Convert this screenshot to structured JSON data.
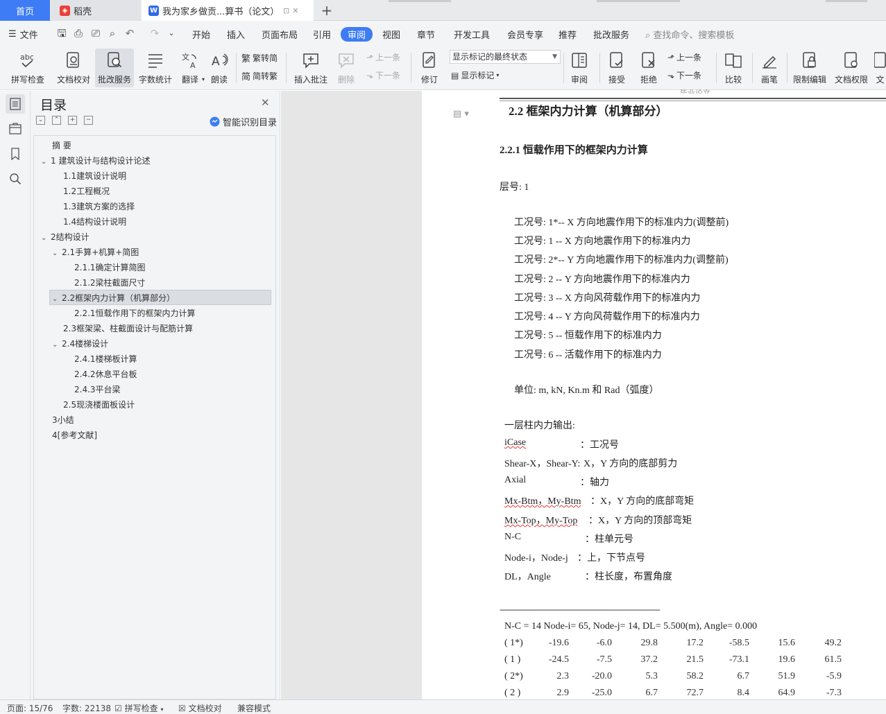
{
  "tabs": {
    "home": "首页",
    "docer": "稻壳",
    "doc_title": "我为家乡做贡...算书（论文）"
  },
  "menu": {
    "file": "文件",
    "items": [
      "开始",
      "插入",
      "页面布局",
      "引用",
      "审阅",
      "视图",
      "章节",
      "开发工具",
      "会员专享",
      "推荐",
      "批改服务"
    ],
    "active": "审阅",
    "search_placeholder": "查找命令、搜索模板"
  },
  "ribbon": {
    "spellcheck": "拼写检查",
    "doc_check": "文档校对",
    "correct_service": "批改服务",
    "word_count": "字数统计",
    "translate": "翻译",
    "read_aloud": "朗读",
    "trad_to_simp": "繁转简",
    "simp_to_trad": "简转繁",
    "insert_comment": "插入批注",
    "delete": "删除",
    "prev_comment": "上一条",
    "next_comment": "下一条",
    "track_changes": "修订",
    "markup_state": "显示标记的最终状态",
    "show_markup": "显示标记",
    "review": "审阅",
    "accept": "接受",
    "reject": "拒绝",
    "prev_change": "上一条",
    "next_change": "下一条",
    "compare": "比较",
    "pen": "画笔",
    "restrict_edit": "限制编辑",
    "doc_permission": "文档权限",
    "more_partial": "文"
  },
  "toc": {
    "title": "目录",
    "smart_recognize": "智能识别目录",
    "items": [
      {
        "label": "摘    要"
      },
      {
        "label": "1  建筑设计与结构设计论述"
      },
      {
        "label": "1.1建筑设计说明"
      },
      {
        "label": "1.2工程概况"
      },
      {
        "label": "1.3建筑方案的选择"
      },
      {
        "label": "1.4结构设计说明"
      },
      {
        "label": "2结构设计"
      },
      {
        "label": "2.1手算+机算+简图"
      },
      {
        "label": "2.1.1确定计算简图"
      },
      {
        "label": "2.1.2梁柱截面尺寸"
      },
      {
        "label": "2.2框架内力计算（机算部分）"
      },
      {
        "label": "2.2.1恒载作用下的框架内力计算"
      },
      {
        "label": "2.3框架梁、柱截面设计与配筋计算"
      },
      {
        "label": "2.4楼梯设计"
      },
      {
        "label": "2.4.1楼梯板计算"
      },
      {
        "label": "2.4.2休息平台板"
      },
      {
        "label": "2.4.3平台梁"
      },
      {
        "label": "2.5现浇楼面板设计"
      },
      {
        "label": "3小结"
      },
      {
        "label": "4[参考文献]"
      }
    ]
  },
  "document": {
    "header_fragment": "毕业论文",
    "section_title": "2.2   框架内力计算（机算部分）",
    "subsection_title": "2.2.1    恒载作用下的框架内力计算",
    "layer": "层号:     1",
    "cases": [
      "工况号:    1*-- X 方向地震作用下的标准内力(调整前)",
      "工况号:    1 -- X 方向地震作用下的标准内力",
      "工况号:    2*-- Y 方向地震作用下的标准内力(调整前)",
      "工况号:    2 -- Y 方向地震作用下的标准内力",
      "工况号:    3 -- X 方向风荷载作用下的标准内力",
      "工况号:    4 -- Y 方向风荷载作用下的标准内力",
      "工况号:    5 --  恒载作用下的标准内力",
      "工况号:    6 --  活载作用下的标准内力"
    ],
    "units": "单位:   m, kN, Kn.m  和  Rad（弧度）",
    "column_output_title": "一层柱内力输出:",
    "legend": [
      {
        "key": "iCase",
        "desc": "：工况号"
      },
      {
        "key": "Shear-X，Shear-Y:",
        "desc": "X，Y 方向的底部剪力"
      },
      {
        "key": "Axial",
        "desc": "：轴力"
      },
      {
        "key": "Mx-Btm，My-Btm",
        "desc": "：X，Y 方向的底部弯矩"
      },
      {
        "key": "Mx-Top，My-Top",
        "desc": "：X，Y 方向的顶部弯矩"
      },
      {
        "key": "N-C",
        "desc": "：柱单元号"
      },
      {
        "key": "Node-i，Node-j",
        "desc": "：上，下节点号"
      },
      {
        "key": "DL，Angle",
        "desc": "：柱长度，布置角度"
      }
    ],
    "dash_line": "-----------------------------------------------------------------------------",
    "column_header": "N-C =    14    Node-i=          65,    Node-j=          14,    DL= 5.500(m),       Angle=        0.000",
    "table_rows": [
      {
        "case": "( 1*)",
        "vals": [
          "-19.6",
          "-6.0",
          "29.8",
          "17.2",
          "-58.5",
          "15.6",
          "49.2"
        ]
      },
      {
        "case": "( 1 )",
        "vals": [
          "-24.5",
          "-7.5",
          "37.2",
          "21.5",
          "-73.1",
          "19.6",
          "61.5"
        ]
      },
      {
        "case": "( 2*)",
        "vals": [
          "2.3",
          "-20.0",
          "5.3",
          "58.2",
          "6.7",
          "51.9",
          "-5.9"
        ]
      },
      {
        "case": "( 2 )",
        "vals": [
          "2.9",
          "-25.0",
          "6.7",
          "72.7",
          "8.4",
          "64.9",
          "-7.3"
        ]
      }
    ]
  },
  "status": {
    "page": "页面: 15/76",
    "words": "字数: 22138",
    "spellcheck": "拼写检查",
    "doc_check": "文档校对",
    "compat": "兼容模式"
  },
  "colors": {
    "accent": "#3d7cf5",
    "ribbon_bg": "#f3f4f6",
    "canvas_bg": "#e6e6e6"
  }
}
